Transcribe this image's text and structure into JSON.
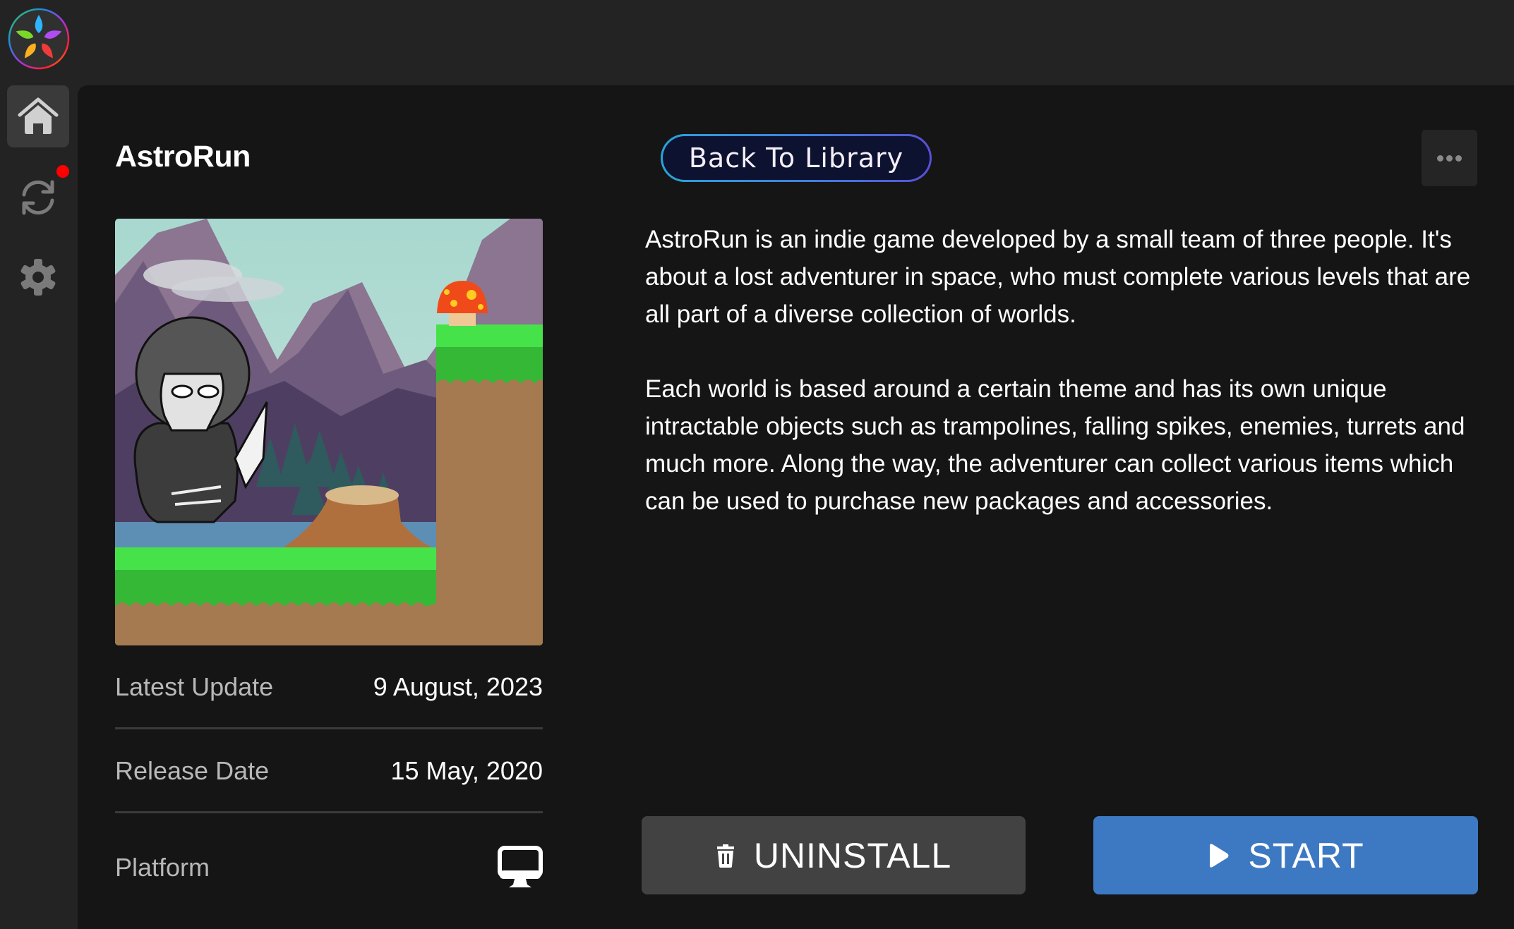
{
  "app": {
    "logo_name": "rainbow-petal-logo",
    "colors": {
      "topbar": "#232323",
      "panel": "#151515",
      "accent_start": "#3d78c3",
      "uninstall_bg": "#424242",
      "notification": "#ff0000"
    }
  },
  "sidebar": {
    "items": [
      {
        "id": "home",
        "icon": "home-icon",
        "active": true
      },
      {
        "id": "updates",
        "icon": "sync-icon",
        "active": false,
        "has_notification": true
      },
      {
        "id": "settings",
        "icon": "gear-icon",
        "active": false
      }
    ]
  },
  "game": {
    "title": "AstroRun",
    "cover_alt": "AstroRun cover art: skull-masked ninja with sword in a mountain platformer level with a mushroom",
    "details": [
      {
        "label": "Latest Update",
        "value": "9 August, 2023"
      },
      {
        "label": "Release Date",
        "value": "15 May, 2020"
      },
      {
        "label": "Platform",
        "value_icon": "desktop-monitor-icon"
      }
    ],
    "description": [
      "AstroRun is an indie game developed by a small team of three people. It's about a lost adventurer in space, who must complete various levels that are all part of a diverse collection of worlds.",
      "Each world is based around a certain theme and has its own unique intractable objects such as trampolines, falling spikes, enemies, turrets and much more. Along the way, the adventurer can collect various items which can be used to purchase new packages and accessories."
    ]
  },
  "header": {
    "back_label": "Back To Library",
    "more_icon": "ellipsis-icon"
  },
  "actions": {
    "uninstall_label": "UNINSTALL",
    "uninstall_icon": "trash-icon",
    "start_label": "START",
    "start_icon": "play-icon"
  }
}
